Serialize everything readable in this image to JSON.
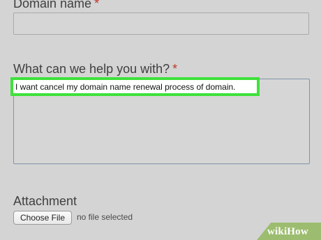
{
  "form": {
    "domain_name": {
      "label": "Domain name",
      "required_marker": "*",
      "value": ""
    },
    "help": {
      "label": "What can we help you with?",
      "required_marker": "*",
      "value": "I want cancel my domain name renewal process of domain."
    },
    "attachment": {
      "label": "Attachment",
      "button_label": "Choose File",
      "status": "no file selected"
    }
  },
  "watermark": {
    "brand": "wikiHow"
  },
  "colors": {
    "background": "#d4d4d4",
    "required": "#c0392b",
    "highlight": "#3ee23a",
    "watermark": "#9cbd6f"
  }
}
